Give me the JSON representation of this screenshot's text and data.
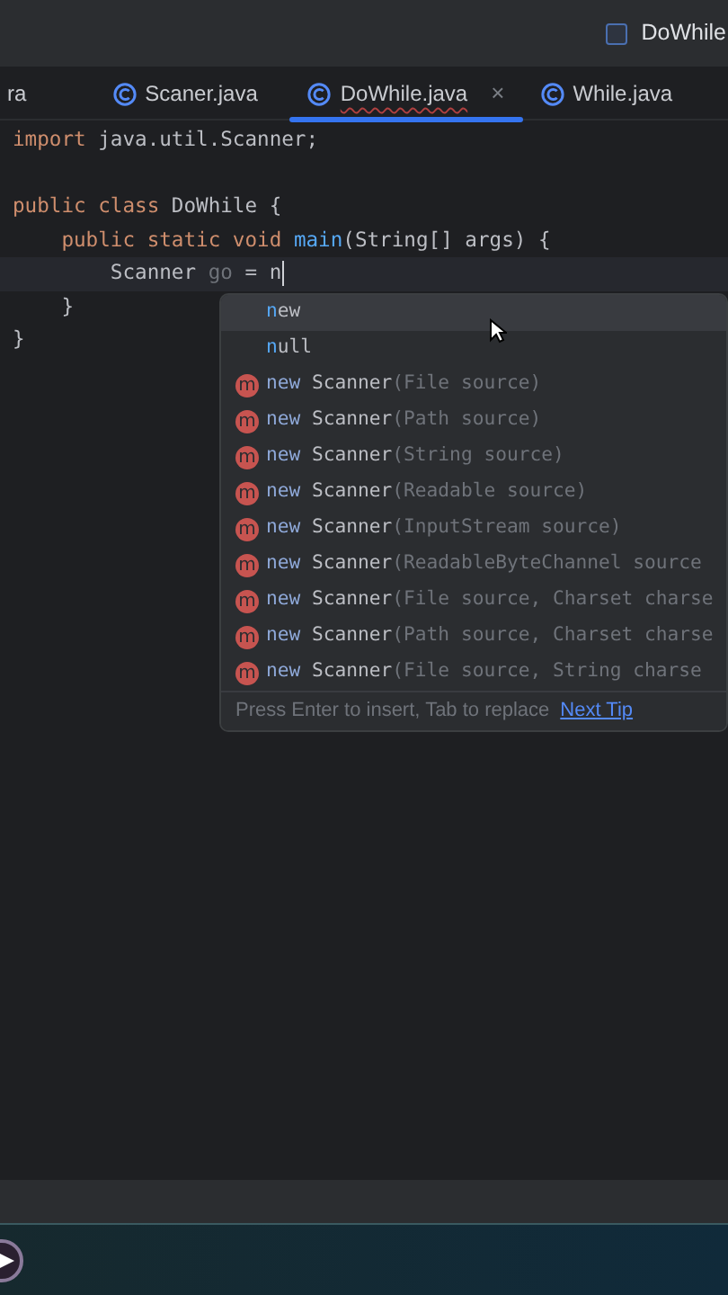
{
  "title_bar": {
    "run_config": "DoWhile"
  },
  "tabs": [
    {
      "label": "ra",
      "selected": false,
      "icon": false
    },
    {
      "label": "Scaner.java",
      "selected": false,
      "icon": true
    },
    {
      "label": "DoWhile.java",
      "selected": true,
      "icon": true,
      "close": "×"
    },
    {
      "label": "While.java",
      "selected": false,
      "icon": true
    }
  ],
  "code": [
    {
      "current": false,
      "tokens": [
        {
          "kind": "keyword",
          "text": "import "
        },
        {
          "kind": "plain",
          "text": "java.util.Scanner;"
        }
      ]
    },
    {
      "current": false
    },
    {
      "current": false,
      "tokens": [
        {
          "kind": "keyword",
          "text": "public class "
        },
        {
          "kind": "plain",
          "text": "DoWhile {"
        }
      ]
    },
    {
      "current": false,
      "tokens": [
        {
          "kind": "keyword",
          "text": "    public static void "
        },
        {
          "kind": "method",
          "text": "main"
        },
        {
          "kind": "plain",
          "text": "(String[] args) {"
        }
      ]
    },
    {
      "current": true,
      "tokens": [
        {
          "kind": "plain",
          "text": "        Scanner "
        },
        {
          "kind": "unused",
          "text": "go"
        },
        {
          "kind": "plain",
          "text": " = n"
        }
      ]
    },
    {
      "current": false,
      "tokens": [
        {
          "kind": "plain",
          "text": "    }"
        }
      ]
    },
    {
      "current": false,
      "tokens": [
        {
          "kind": "plain",
          "text": "}"
        }
      ]
    }
  ],
  "completion": {
    "items": [
      {
        "kind": "keyword",
        "selected": true,
        "match": "n",
        "rest": "ew"
      },
      {
        "kind": "keyword",
        "selected": false,
        "match": "n",
        "rest": "ull"
      },
      {
        "kind": "constructor",
        "selected": false,
        "icon": "m",
        "word": "new",
        "name": "Scanner",
        "params": "(File source)"
      },
      {
        "kind": "constructor",
        "selected": false,
        "icon": "m",
        "word": "new",
        "name": "Scanner",
        "params": "(Path source)"
      },
      {
        "kind": "constructor",
        "selected": false,
        "icon": "m",
        "word": "new",
        "name": "Scanner",
        "params": "(String source)"
      },
      {
        "kind": "constructor",
        "selected": false,
        "icon": "m",
        "word": "new",
        "name": "Scanner",
        "params": "(Readable source)"
      },
      {
        "kind": "constructor",
        "selected": false,
        "icon": "m",
        "word": "new",
        "name": "Scanner",
        "params": "(InputStream source)"
      },
      {
        "kind": "constructor",
        "selected": false,
        "icon": "m",
        "word": "new",
        "name": "Scanner",
        "params": "(ReadableByteChannel source"
      },
      {
        "kind": "constructor",
        "selected": false,
        "icon": "m",
        "word": "new",
        "name": "Scanner",
        "params": "(File source, Charset charse"
      },
      {
        "kind": "constructor",
        "selected": false,
        "icon": "m",
        "word": "new",
        "name": "Scanner",
        "params": "(Path source, Charset charse"
      },
      {
        "kind": "constructor",
        "selected": false,
        "icon": "m",
        "word": "new",
        "name": "Scanner",
        "params": "(File source, String charse"
      }
    ],
    "hint": "Press Enter to insert, Tab to replace",
    "tip_link": "Next Tip"
  }
}
